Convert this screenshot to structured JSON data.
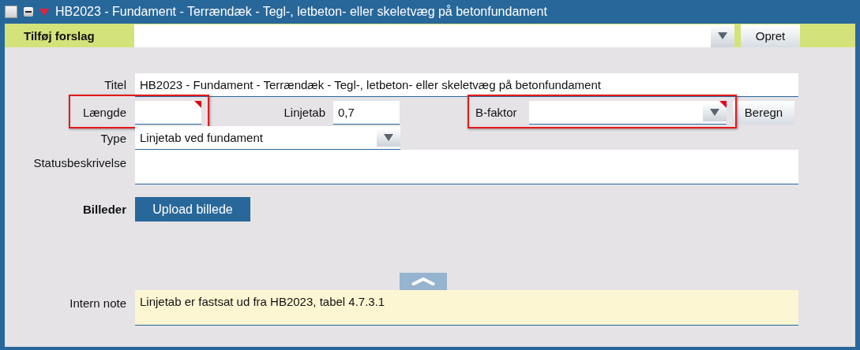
{
  "window": {
    "title": "HB2023 - Fundament - Terrændæk - Tegl-, letbeton- eller skeletvæg på betonfundament",
    "expanded": true,
    "checked": false
  },
  "suggestion_bar": {
    "label": "Tilføj forslag",
    "button": "Opret"
  },
  "form": {
    "title": {
      "label": "Titel",
      "value": "HB2023 - Fundament - Terrændæk - Tegl-, letbeton- eller skeletvæg på betonfundament"
    },
    "length": {
      "label": "Længde",
      "required": true,
      "highlighted": true
    },
    "line_loss": {
      "label": "Linjetab",
      "value": "0,7"
    },
    "b_factor": {
      "label": "B-faktor",
      "required": true,
      "highlighted": true
    },
    "calculate_button": "Beregn",
    "type": {
      "label": "Type",
      "value": "Linjetab ved fundament"
    },
    "status_description": {
      "label": "Statusbeskrivelse"
    },
    "images": {
      "label": "Billeder",
      "button": "Upload billede"
    },
    "internal_note": {
      "label": "Intern note",
      "value": "Linjetab er fastsat ud fra HB2023, tabel 4.7.3.1"
    }
  }
}
